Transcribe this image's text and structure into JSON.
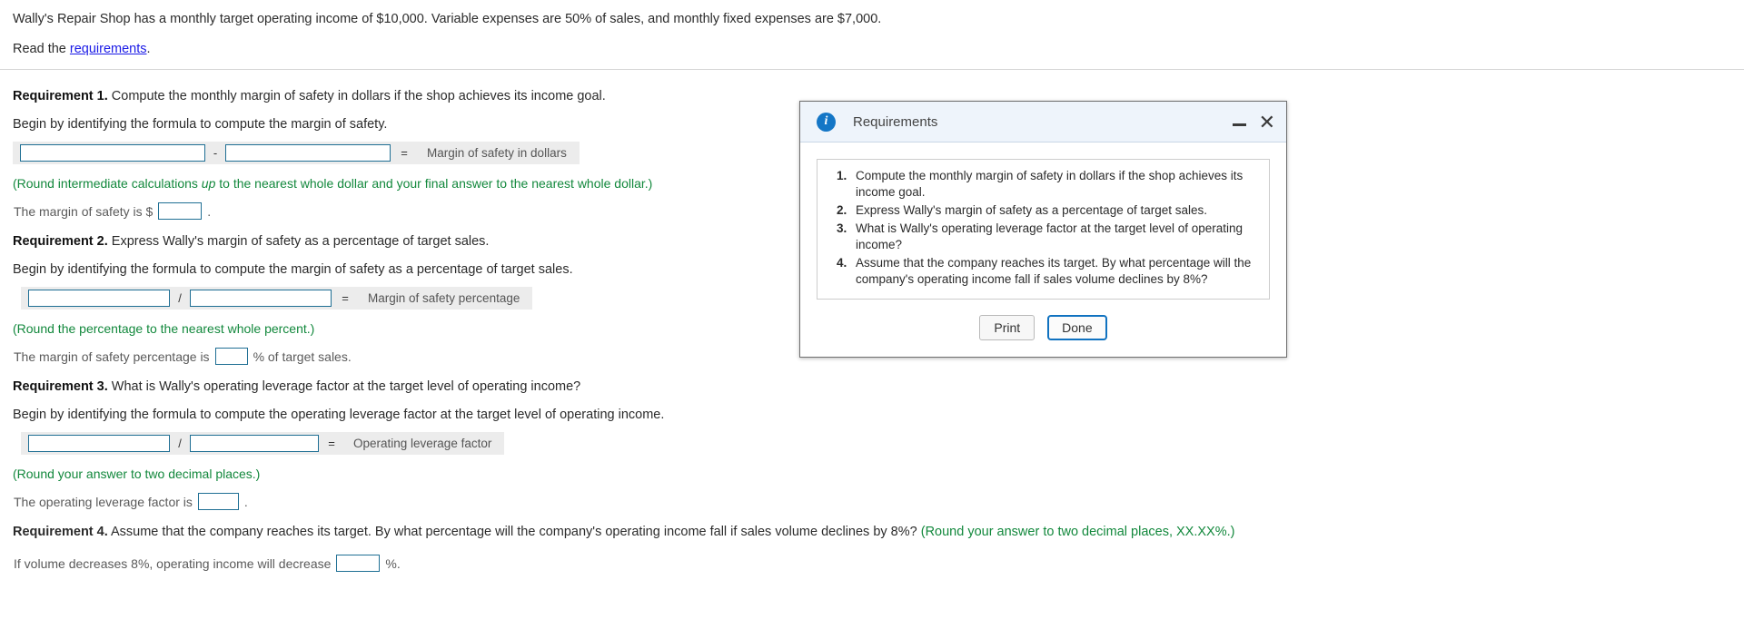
{
  "problem": {
    "statement": "Wally's Repair Shop has a monthly target operating income of $10,000. Variable expenses are 50% of sales, and monthly fixed expenses are $7,000.",
    "read_prefix": "Read the ",
    "read_link": "requirements",
    "read_suffix": "."
  },
  "requirement1": {
    "label": "Requirement 1.",
    "title": " Compute the monthly margin of safety in dollars if the shop achieves its income goal.",
    "begin": "Begin by identifying the formula to compute the margin of safety.",
    "formula": {
      "input1_value": "",
      "input2_value": "",
      "operator": "-",
      "equals": "=",
      "result_label": "Margin of safety in dollars"
    },
    "note": "(Round intermediate calculations ",
    "note_italic": "up",
    "note_rest": " to the nearest whole dollar and your final answer to the nearest whole dollar.)",
    "answer_prefix": "The margin of safety is $",
    "answer_value": "",
    "answer_suffix": "."
  },
  "requirement2": {
    "label": "Requirement 2.",
    "title": " Express Wally's margin of safety as a percentage of target sales.",
    "begin": "Begin by identifying the formula to compute the margin of safety as a percentage of target sales.",
    "formula": {
      "input1_value": "",
      "input2_value": "",
      "operator": "/",
      "equals": "=",
      "result_label": "Margin of safety percentage"
    },
    "note": "(Round the percentage to the nearest whole percent.)",
    "answer_prefix": "The margin of safety percentage is",
    "answer_value": "",
    "answer_suffix": "% of target sales."
  },
  "requirement3": {
    "label": "Requirement 3.",
    "title": " What is Wally's operating leverage factor at the target level of operating income?",
    "begin": "Begin by identifying the formula to compute the operating leverage factor at the target level of operating income.",
    "formula": {
      "input1_value": "",
      "input2_value": "",
      "operator": "/",
      "equals": "=",
      "result_label": "Operating leverage factor"
    },
    "note": "(Round your answer to two decimal places.)",
    "answer_prefix": "The operating leverage factor is",
    "answer_value": "",
    "answer_suffix": "."
  },
  "requirement4": {
    "label": "Requirement 4.",
    "title": " Assume that the company reaches its target. By what percentage will the company's operating income fall if sales volume declines by 8%? ",
    "note": "(Round your answer to two decimal places, XX.XX%.)",
    "answer_prefix": "If volume decreases 8%, operating income will decrease",
    "answer_value": "",
    "answer_suffix": "%."
  },
  "dialog": {
    "title": "Requirements",
    "info_icon": "info-icon",
    "minimize_icon": "minimize-icon",
    "close_icon": "close-icon",
    "items": [
      "Compute the monthly margin of safety in dollars if the shop achieves its income goal.",
      "Express Wally's margin of safety as a percentage of target sales.",
      "What is Wally's operating leverage factor at the target level of operating income?",
      "Assume that the company reaches its target. By what percentage will the company's operating income fall if sales volume declines by 8%?"
    ],
    "print_label": "Print",
    "done_label": "Done"
  },
  "colors": {
    "link": "#1a1ae6",
    "green_note": "#12883c",
    "input_border": "#1f6f94",
    "dialog_accent": "#1476c6"
  }
}
